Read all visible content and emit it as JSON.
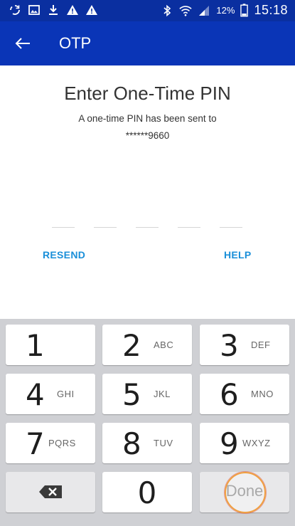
{
  "status_bar": {
    "battery_percent": "12%",
    "time": "15:18",
    "left_icons": [
      "sync-icon",
      "image-icon",
      "download-icon",
      "warning-icon",
      "warning-icon"
    ],
    "right_icons": [
      "bluetooth-icon",
      "wifi-icon",
      "signal-icon",
      "battery-icon"
    ]
  },
  "app_bar": {
    "title": "OTP",
    "back_icon": "arrow-left-icon",
    "color": "#0a35b7"
  },
  "content": {
    "heading": "Enter One-Time PIN",
    "subtext": "A one-time PIN has been sent to",
    "masked_phone": "******9660",
    "pin_slot_count": 5,
    "resend_label": "RESEND",
    "help_label": "HELP",
    "link_color": "#1a8fd9"
  },
  "keyboard": {
    "keys": [
      {
        "digit": "1",
        "letters": ""
      },
      {
        "digit": "2",
        "letters": "ABC"
      },
      {
        "digit": "3",
        "letters": "DEF"
      },
      {
        "digit": "4",
        "letters": "GHI"
      },
      {
        "digit": "5",
        "letters": "JKL"
      },
      {
        "digit": "6",
        "letters": "MNO"
      },
      {
        "digit": "7",
        "letters": "PQRS"
      },
      {
        "digit": "8",
        "letters": "TUV"
      },
      {
        "digit": "9",
        "letters": "WXYZ"
      },
      {
        "digit": "0",
        "letters": ""
      }
    ],
    "backspace_icon": "backspace-icon",
    "done_label": "Done"
  }
}
